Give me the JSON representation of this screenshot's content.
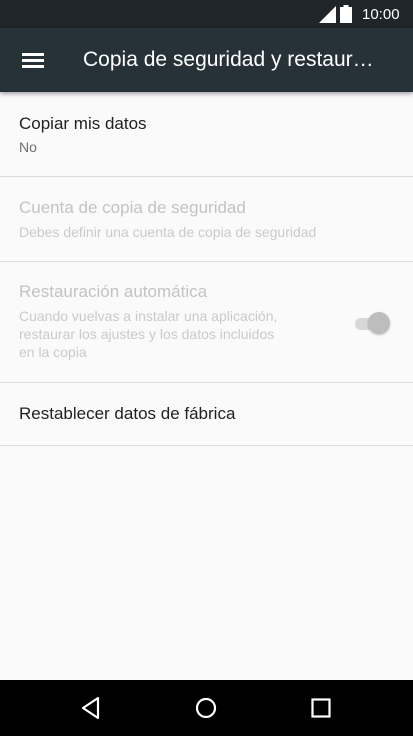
{
  "status_bar": {
    "time": "10:00",
    "icons": [
      "cell-signal-icon",
      "battery-icon"
    ]
  },
  "app_bar": {
    "menu_icon": "hamburger-menu-icon",
    "title": "Copia de seguridad y restaur…"
  },
  "settings": [
    {
      "title": "Copiar mis datos",
      "summary": "No",
      "enabled": true
    },
    {
      "title": "Cuenta de copia de seguridad",
      "summary": "Debes definir una cuenta de copia de seguridad",
      "enabled": false
    },
    {
      "title": "Restauración automática",
      "summary_lines": [
        "Cuando vuelvas a instalar una aplicación,",
        "restaurar los ajustes y los datos incluidos",
        "en la copia"
      ],
      "enabled": false,
      "toggle": {
        "state": "on",
        "enabled": false
      }
    },
    {
      "title": "Restablecer datos de fábrica",
      "enabled": true
    }
  ],
  "nav_bar": {
    "buttons": [
      "back-icon",
      "home-icon",
      "recents-icon"
    ]
  },
  "colors": {
    "status_bar": "#1f2529",
    "app_bar": "#263238",
    "background": "#fafafa",
    "nav_bar": "#000000"
  }
}
